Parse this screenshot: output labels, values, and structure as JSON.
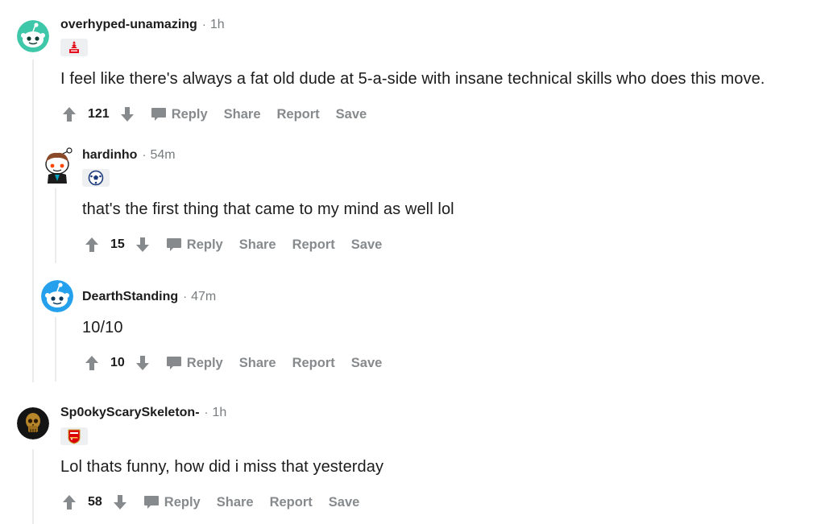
{
  "comments": [
    {
      "username": "overhyped-unamazing",
      "separator": "·",
      "time": "1h",
      "body": "I feel like there's always a fat old dude at 5-a-side with insane technical skills who does this move.",
      "score": "121",
      "avatar_icon": "snoo-green-avatar",
      "flair_icon": "nottingham-forest-crest-icon"
    },
    {
      "username": "hardinho",
      "separator": "·",
      "time": "54m",
      "body": "that's the first thing that came to my mind as well lol",
      "score": "15",
      "avatar_icon": "snoo-brown-hair-avatar",
      "flair_icon": "football-icon"
    },
    {
      "username": "DearthStanding",
      "separator": "·",
      "time": "47m",
      "body": "10/10",
      "score": "10",
      "avatar_icon": "snoo-blue-avatar"
    },
    {
      "username": "Sp0okyScarySkeleton-",
      "separator": "·",
      "time": "1h",
      "body": "Lol thats funny, how did i miss that yesterday",
      "score": "58",
      "avatar_icon": "golden-skull-avatar",
      "flair_icon": "arsenal-crest-icon"
    }
  ],
  "actions": {
    "reply": "Reply",
    "share": "Share",
    "report": "Report",
    "save": "Save"
  },
  "colors": {
    "meta_gray": "#787c7e",
    "action_gray": "#878a8c",
    "thread_line": "#e9ebed",
    "flair_bg": "#edeff1"
  }
}
